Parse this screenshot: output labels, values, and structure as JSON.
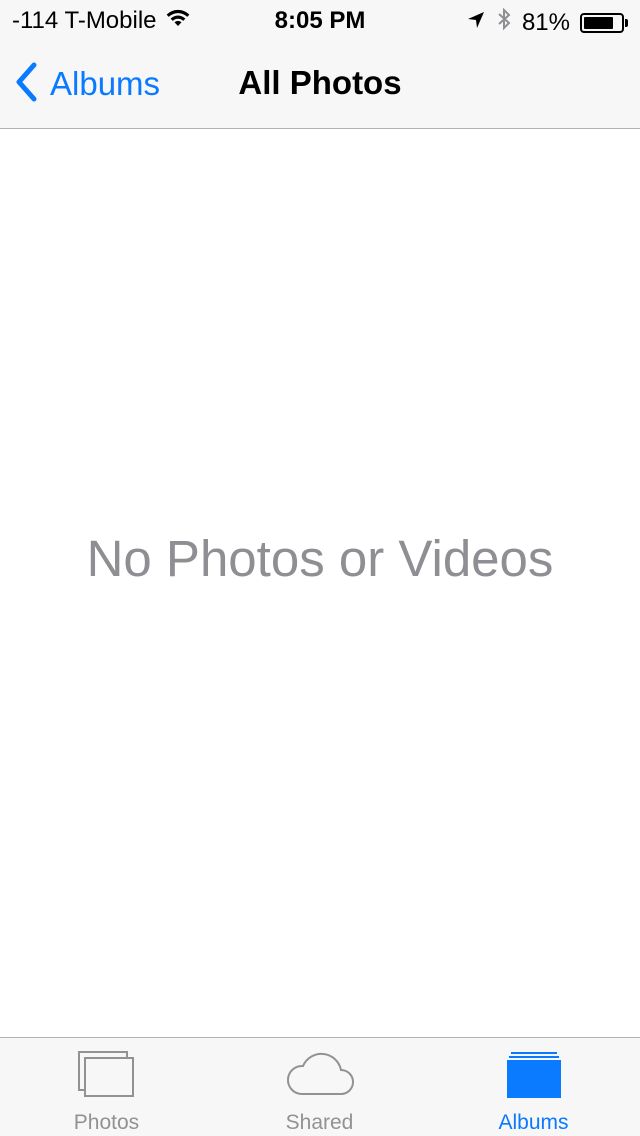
{
  "status_bar": {
    "carrier": "-114 T-Mobile",
    "time": "8:05 PM",
    "battery_percent": "81%",
    "battery_level": 0.81,
    "icons": [
      "wifi-icon",
      "location-arrow-icon",
      "bluetooth-icon",
      "battery-icon"
    ]
  },
  "nav": {
    "back_label": "Albums",
    "title": "All Photos"
  },
  "content": {
    "empty_message": "No Photos or Videos"
  },
  "tabs": [
    {
      "label": "Photos",
      "icon": "photos-icon",
      "active": false
    },
    {
      "label": "Shared",
      "icon": "cloud-icon",
      "active": false
    },
    {
      "label": "Albums",
      "icon": "albums-icon",
      "active": true
    }
  ],
  "colors": {
    "accent": "#0a7aff",
    "inactive": "#929292",
    "empty_text": "#8e8e93",
    "bar_background": "#f7f7f7"
  }
}
